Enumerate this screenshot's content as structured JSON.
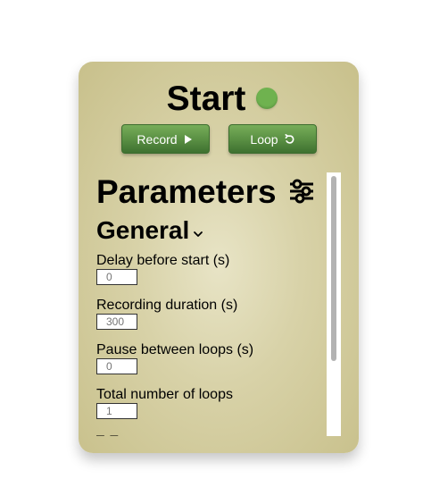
{
  "status": {
    "title": "Start",
    "indicator_color": "#6fb24f"
  },
  "buttons": {
    "record": {
      "label": "Record",
      "icon": "play-icon"
    },
    "loop": {
      "label": "Loop",
      "icon": "refresh-icon"
    }
  },
  "parameters": {
    "title": "Parameters",
    "icon": "sliders-icon",
    "section": {
      "title": "General",
      "icon": "chevron-down-icon",
      "fields": [
        {
          "label": "Delay before start (s)",
          "placeholder": "0"
        },
        {
          "label": "Recording duration (s)",
          "placeholder": "300"
        },
        {
          "label": "Pause between loops (s)",
          "placeholder": "0"
        },
        {
          "label": "Total number of loops",
          "placeholder": "1"
        }
      ],
      "trailing_text": "– –"
    }
  },
  "colors": {
    "button_green": "#5c9245",
    "panel_beige": "#d8d2a8"
  }
}
